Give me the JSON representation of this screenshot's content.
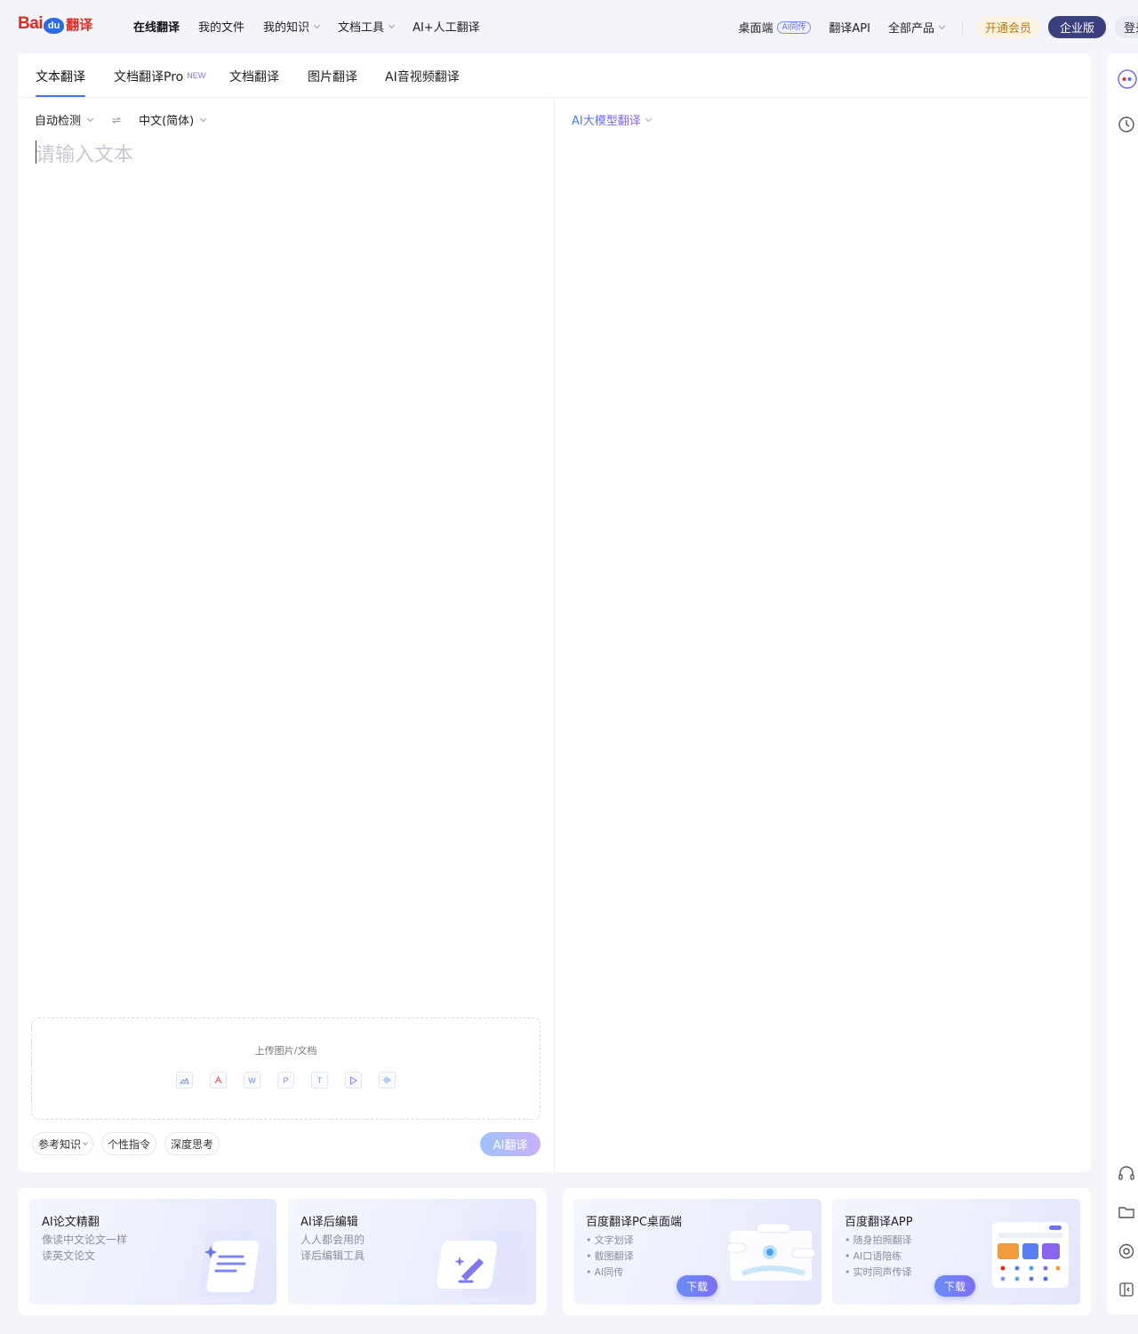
{
  "logo": {
    "bai": "Bai",
    "du": "du",
    "fanyi": "翻译"
  },
  "nav": [
    {
      "label": "在线翻译",
      "active": true,
      "dropdown": false
    },
    {
      "label": "我的文件",
      "active": false,
      "dropdown": false
    },
    {
      "label": "我的知识",
      "active": false,
      "dropdown": true
    },
    {
      "label": "文档工具",
      "active": false,
      "dropdown": true
    },
    {
      "label": "AI+人工翻译",
      "active": false,
      "dropdown": false
    }
  ],
  "header_right": {
    "desktop": "桌面端",
    "desktop_badge": "AI同传",
    "api": "翻译API",
    "all_products": "全部产品",
    "vip": "开通会员",
    "enterprise": "企业版",
    "login": "登录"
  },
  "tabs": [
    {
      "label": "文本翻译",
      "active": true
    },
    {
      "label": "文档翻译Pro",
      "badge": "NEW",
      "active": false
    },
    {
      "label": "文档翻译",
      "active": false
    },
    {
      "label": "图片翻译",
      "active": false
    },
    {
      "label": "AI音视频翻译",
      "active": false
    }
  ],
  "source": {
    "lang_from": "自动检测",
    "lang_to": "中文(简体)",
    "placeholder": "请输入文本",
    "upload_label": "上传图片/文档",
    "upload_types": [
      "image-icon",
      "pdf-icon",
      "word-icon",
      "ppt-icon",
      "txt-icon",
      "video-icon",
      "audio-icon"
    ]
  },
  "target": {
    "model_label": "AI大模型翻译"
  },
  "tools": {
    "knowledge": "参考知识",
    "instructions": "个性指令",
    "deep_think": "深度思考",
    "translate_button": "AI翻译"
  },
  "promos": {
    "paper": {
      "title": "AI论文精翻",
      "desc1": "像读中文论文一样",
      "desc2": "读英文论文"
    },
    "post_edit": {
      "title": "AI译后编辑",
      "desc1": "人人都会用的",
      "desc2": "译后编辑工具"
    },
    "pc": {
      "title": "百度翻译PC桌面端",
      "bullets": [
        "文字划译",
        "截图翻译",
        "AI同传"
      ],
      "download": "下载"
    },
    "app": {
      "title": "百度翻译APP",
      "bullets": [
        "随身拍照翻译",
        "AI口语陪练",
        "实时同声传译"
      ],
      "download": "下载"
    }
  },
  "colors": {
    "accent": "#4a6cf7",
    "brand_red": "#e5281f",
    "enterprise_bg": "#3a3f7d",
    "vip_text": "#c07b13"
  }
}
